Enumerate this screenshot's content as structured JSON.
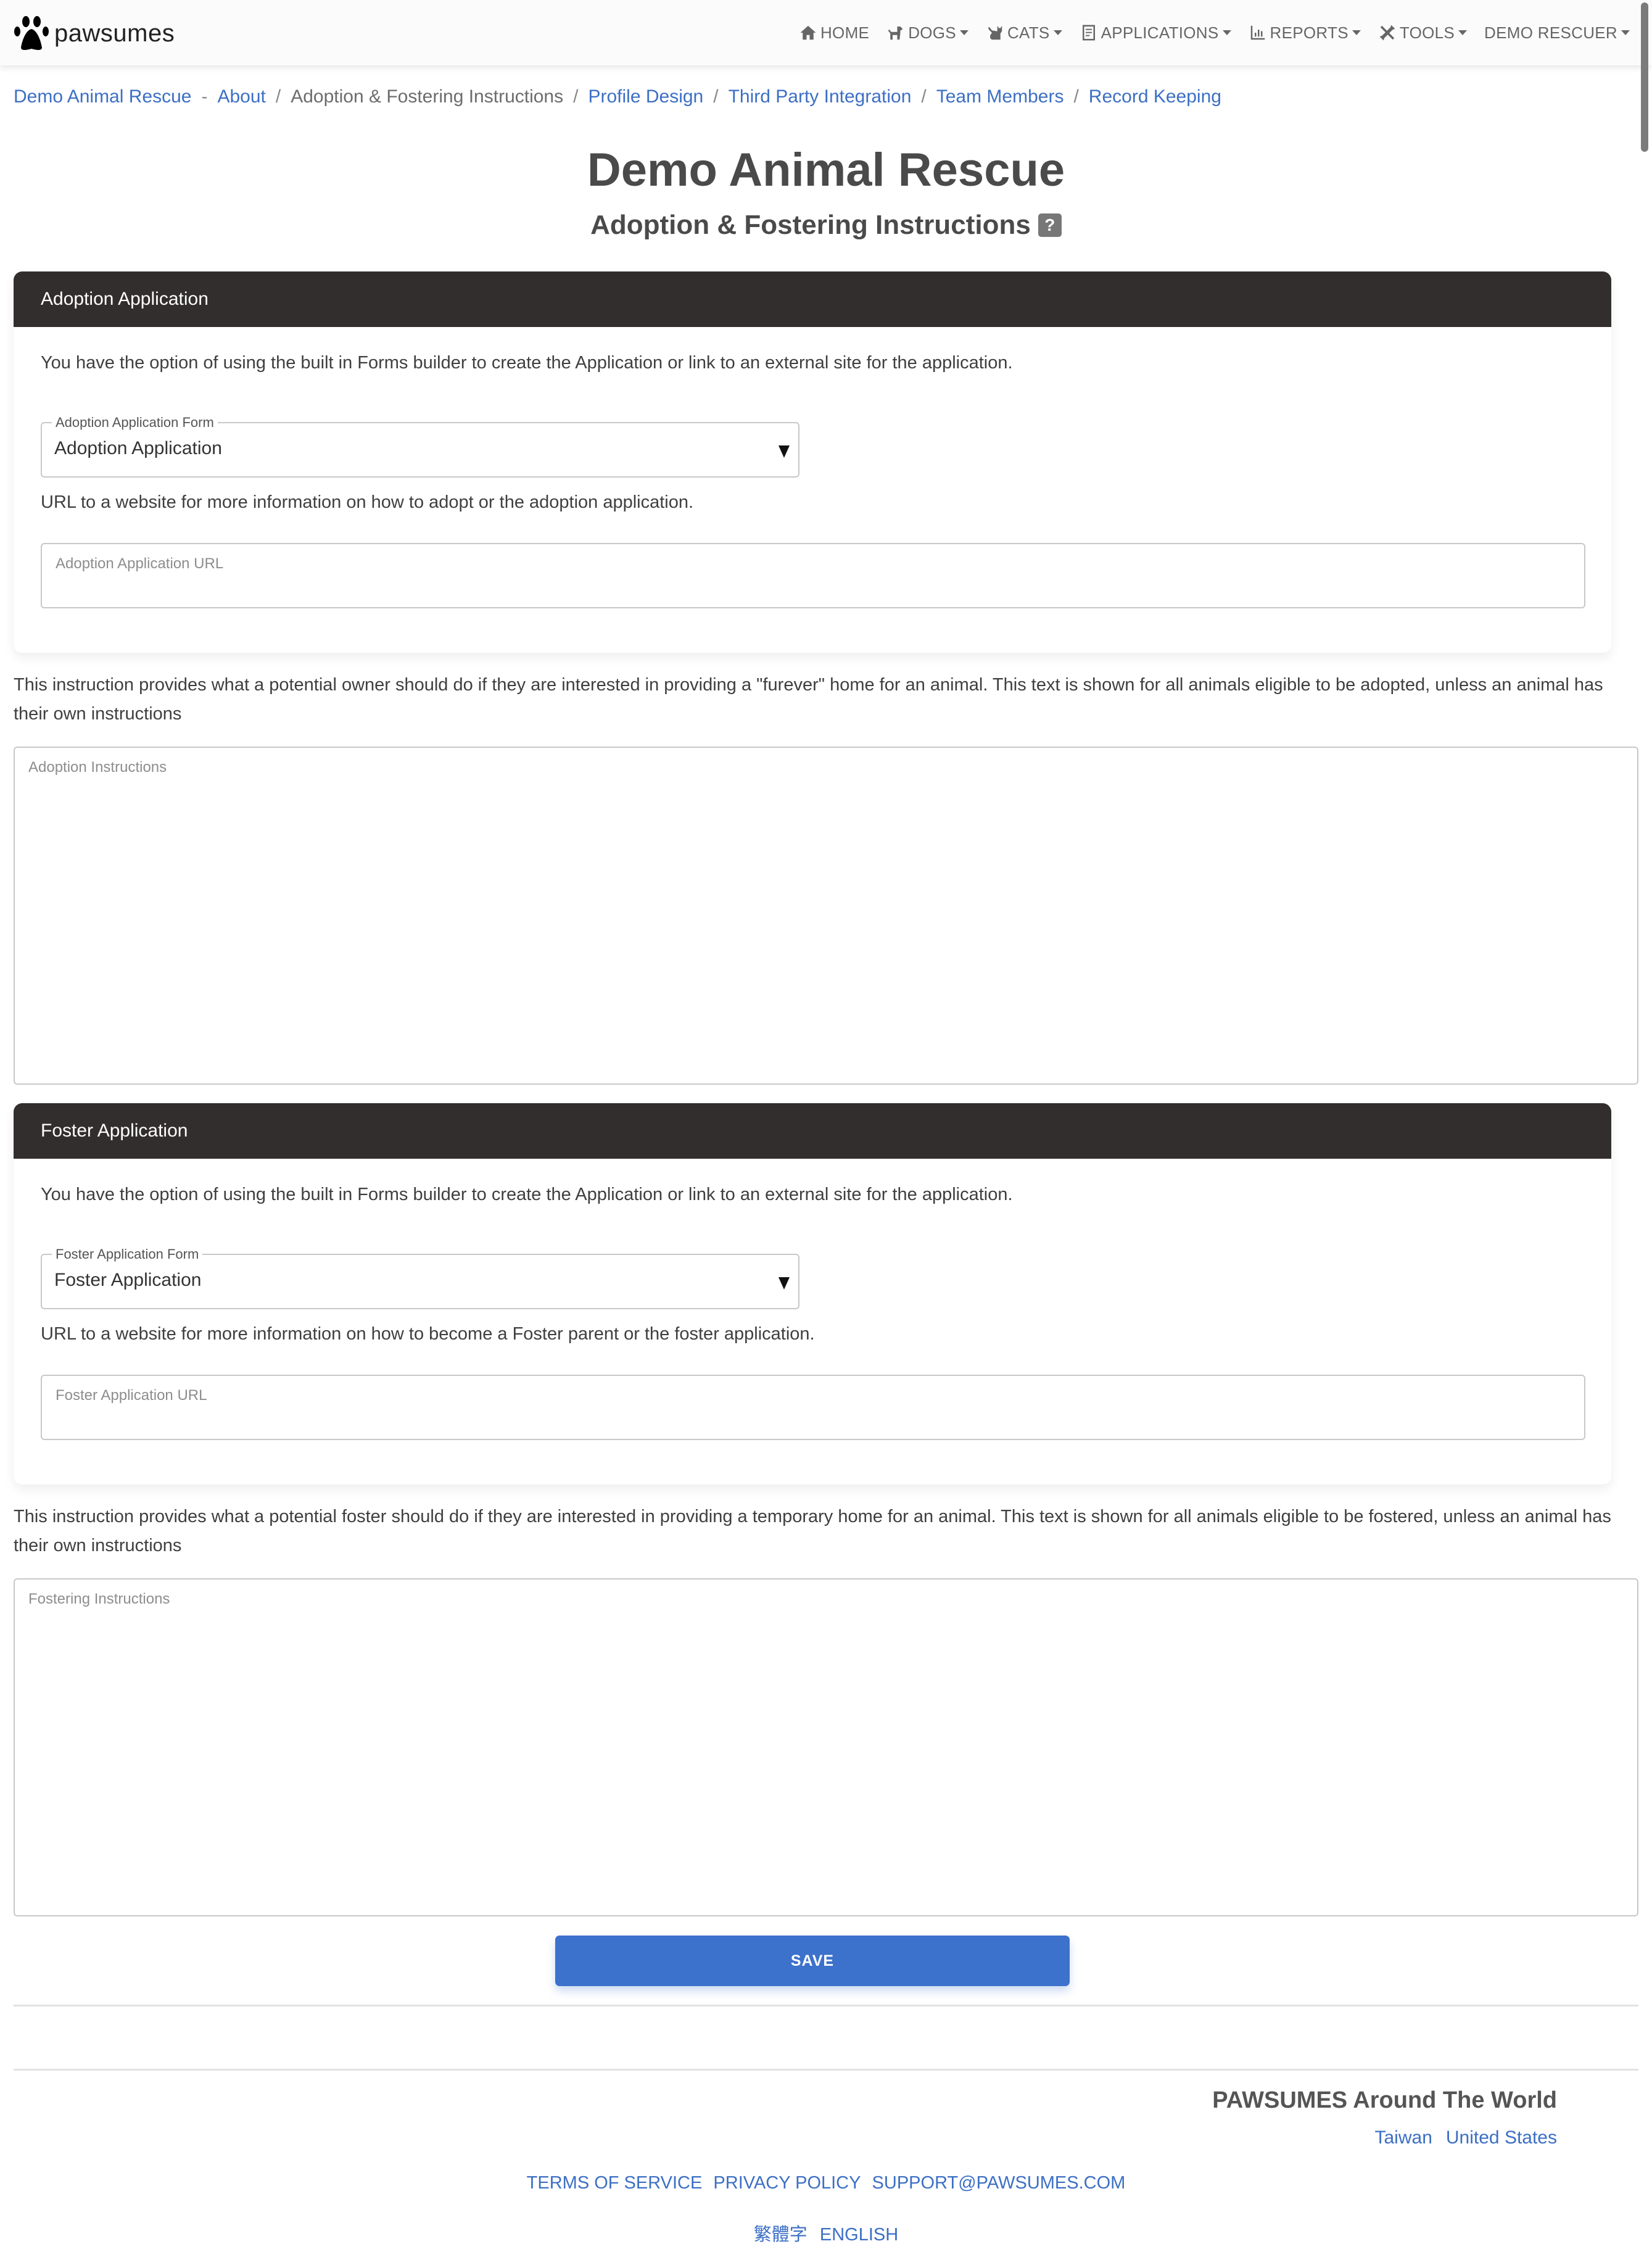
{
  "app": {
    "brand": "pawsumes"
  },
  "nav": {
    "items": [
      {
        "label": "HOME",
        "icon": "home-icon",
        "dropdown": false
      },
      {
        "label": "DOGS",
        "icon": "dog-icon",
        "dropdown": true
      },
      {
        "label": "CATS",
        "icon": "cat-icon",
        "dropdown": true
      },
      {
        "label": "APPLICATIONS",
        "icon": "clipboard-icon",
        "dropdown": true
      },
      {
        "label": "REPORTS",
        "icon": "bar-chart-icon",
        "dropdown": true
      },
      {
        "label": "TOOLS",
        "icon": "tools-icon",
        "dropdown": true
      },
      {
        "label": "DEMO RESCUER",
        "icon": null,
        "dropdown": true
      }
    ]
  },
  "breadcrumb": {
    "root": "Demo Animal Rescue",
    "root_sep": "-",
    "sep": "/",
    "items": [
      {
        "label": "About",
        "current": false
      },
      {
        "label": "Adoption & Fostering Instructions",
        "current": true
      },
      {
        "label": "Profile Design",
        "current": false
      },
      {
        "label": "Third Party Integration",
        "current": false
      },
      {
        "label": "Team Members",
        "current": false
      },
      {
        "label": "Record Keeping",
        "current": false
      }
    ]
  },
  "page": {
    "title": "Demo Animal Rescue",
    "subtitle": "Adoption & Fostering Instructions",
    "help_glyph": "?"
  },
  "adoption": {
    "header": "Adoption Application",
    "intro": "You have the option of using the built in Forms builder to create the Application or link to an external site for the application.",
    "form_select": {
      "legend": "Adoption Application Form",
      "value": "Adoption Application"
    },
    "url_text": "URL to a website for more information on how to adopt or the adoption application.",
    "url_input": {
      "placeholder": "Adoption Application URL",
      "value": ""
    },
    "instructions_text": "This instruction provides what a potential owner should do if they are interested in providing a \"furever\" home for an animal. This text is shown for all animals eligible to be adopted, unless an animal has their own instructions",
    "instructions_input": {
      "placeholder": "Adoption Instructions",
      "value": ""
    }
  },
  "foster": {
    "header": "Foster Application",
    "intro": "You have the option of using the built in Forms builder to create the Application or link to an external site for the application.",
    "form_select": {
      "legend": "Foster Application Form",
      "value": "Foster Application"
    },
    "url_text": "URL to a website for more information on how to become a Foster parent or the foster application.",
    "url_input": {
      "placeholder": "Foster Application URL",
      "value": ""
    },
    "instructions_text": "This instruction provides what a potential foster should do if they are interested in providing a temporary home for an animal. This text is shown for all animals eligible to be fostered, unless an animal has their own instructions",
    "instructions_input": {
      "placeholder": "Fostering Instructions",
      "value": ""
    }
  },
  "actions": {
    "save_label": "SAVE"
  },
  "footer": {
    "world_title": "PAWSUMES Around The World",
    "countries": [
      "Taiwan",
      "United States"
    ],
    "legal": [
      "TERMS OF SERVICE",
      "PRIVACY POLICY",
      "SUPPORT@PAWSUMES.COM"
    ],
    "languages": [
      "繁體字",
      "ENGLISH"
    ]
  },
  "colors": {
    "accent": "#3c71cc",
    "link": "#3c6fc4",
    "card_header": "#332e2e",
    "text": "#3f3f3f"
  }
}
